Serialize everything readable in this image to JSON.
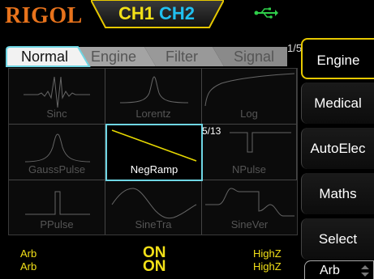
{
  "header": {
    "logo": "RIGOL",
    "channels": [
      "CH1",
      "CH2"
    ],
    "usb_icon": "usb-icon"
  },
  "tabs": {
    "items": [
      {
        "label": "Normal",
        "active": true
      },
      {
        "label": "Engine",
        "active": false
      },
      {
        "label": "Filter",
        "active": false
      },
      {
        "label": "Signal",
        "active": false
      }
    ],
    "page": "1/5"
  },
  "grid": {
    "page": "5/13",
    "waveforms": [
      {
        "label": "Sinc",
        "icon": "sinc-wave-icon",
        "selected": false
      },
      {
        "label": "Lorentz",
        "icon": "lorentz-wave-icon",
        "selected": false
      },
      {
        "label": "Log",
        "icon": "log-wave-icon",
        "selected": false
      },
      {
        "label": "GaussPulse",
        "icon": "gauss-pulse-icon",
        "selected": false
      },
      {
        "label": "NegRamp",
        "icon": "neg-ramp-icon",
        "selected": true
      },
      {
        "label": "NPulse",
        "icon": "npulse-icon",
        "selected": false
      },
      {
        "label": "PPulse",
        "icon": "ppulse-icon",
        "selected": false
      },
      {
        "label": "SineTra",
        "icon": "sine-tra-icon",
        "selected": false
      },
      {
        "label": "SineVer",
        "icon": "sine-ver-icon",
        "selected": false
      }
    ]
  },
  "softkeys": [
    {
      "label": "Engine",
      "active": true
    },
    {
      "label": "Medical",
      "active": false
    },
    {
      "label": "AutoElec",
      "active": false
    },
    {
      "label": "Maths",
      "active": false
    },
    {
      "label": "Select",
      "active": false
    }
  ],
  "bottom_key": {
    "label": "Arb"
  },
  "status": {
    "ch1": {
      "mode": "Arb",
      "output": "ON",
      "load": "HighZ"
    },
    "ch2": {
      "mode": "Arb",
      "output": "ON",
      "load": "HighZ"
    }
  },
  "colors": {
    "ch1": "#f2e018",
    "ch2": "#20c0f0",
    "logo": "#e8731c",
    "selection": "#6fd6e4",
    "active_softkey": "#e6c800"
  }
}
